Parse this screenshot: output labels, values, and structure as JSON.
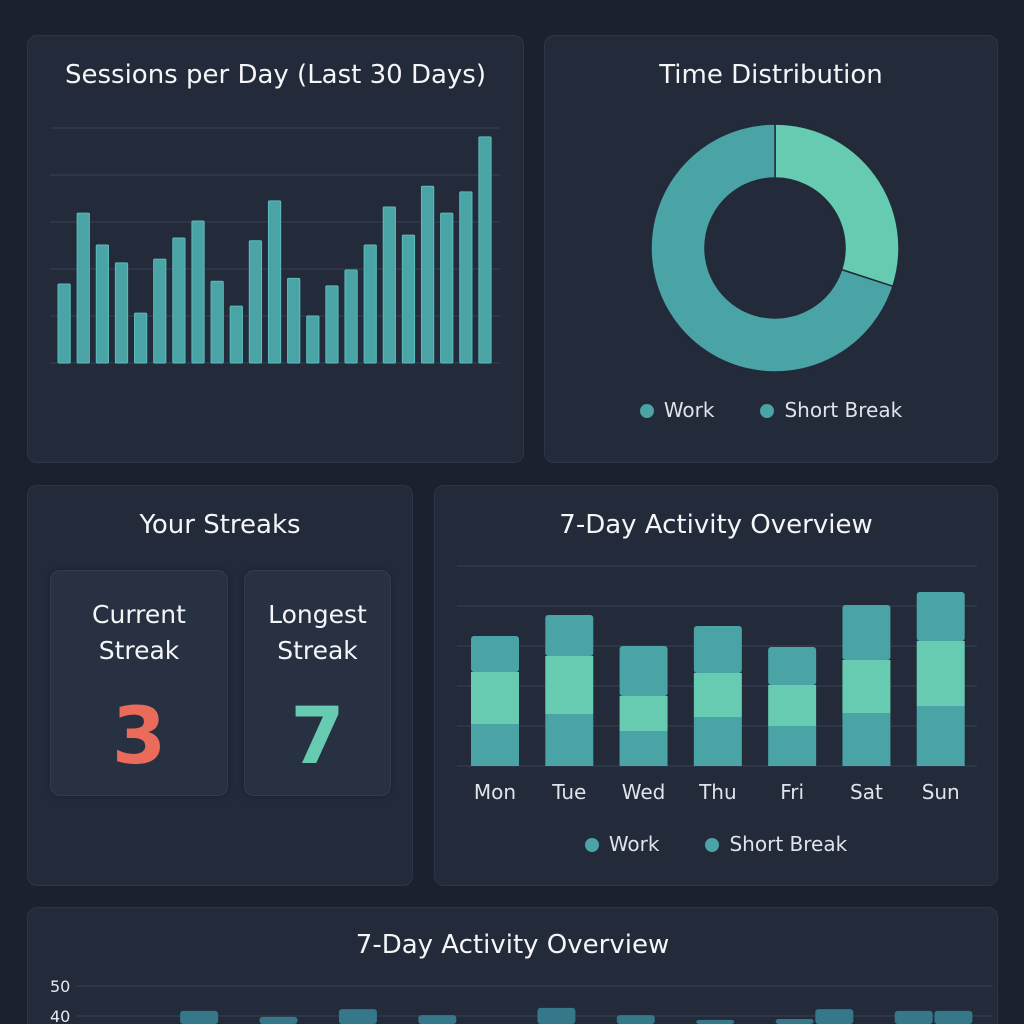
{
  "colors": {
    "work": "#4aa3a5",
    "short_break": "#66cbb0",
    "current": "#ea6b5a",
    "longest": "#66cbb0",
    "grid": "#2f3a4b",
    "bottom_bar": "#34788a"
  },
  "sessions": {
    "title": "Sessions per Day (Last 30 Days)",
    "chart_data": {
      "type": "bar",
      "values": [
        16.8,
        31.9,
        25.1,
        21.3,
        10.6,
        22.1,
        26.6,
        30.2,
        17.4,
        12.1,
        26,
        34.5,
        18,
        10,
        16.4,
        19.8,
        25.1,
        33.2,
        27.2,
        37.6,
        31.9,
        36.4,
        48.1
      ],
      "ylim": [
        0,
        50
      ],
      "grid": true
    }
  },
  "distribution": {
    "title": "Time Distribution",
    "chart_data": {
      "type": "pie",
      "labels": [
        "Work",
        "Short Break"
      ],
      "values": [
        70,
        30
      ]
    },
    "legend": [
      "Work",
      "Short Break"
    ]
  },
  "streaks": {
    "title": "Your Streaks",
    "current_label_1": "Current",
    "current_label_2": "Streak",
    "current_value": "3",
    "longest_label_1": "Longest",
    "longest_label_2": "Streak",
    "longest_value": "7"
  },
  "activity": {
    "title": "7-Day Activity Overview",
    "chart_data": {
      "type": "bar",
      "stacked": true,
      "categories": [
        "Mon",
        "Tue",
        "Wed",
        "Thu",
        "Fri",
        "Sat",
        "Sun"
      ],
      "series": [
        {
          "name": "Work",
          "values": [
            10.5,
            13,
            8.75,
            12.25,
            10,
            13.25,
            15
          ]
        },
        {
          "name": "Short Break",
          "values": [
            13,
            14.5,
            8.75,
            11,
            10.25,
            13.25,
            16.25
          ]
        },
        {
          "name": "Work",
          "values": [
            9,
            10.25,
            12.5,
            11.75,
            9.5,
            13.75,
            12.25
          ]
        }
      ],
      "ylim": [
        0,
        50
      ]
    },
    "legend": [
      "Work",
      "Short Break"
    ]
  },
  "bottom": {
    "title": "7-Day Activity Overview",
    "chart_data": {
      "type": "bar",
      "yticks": [
        "50",
        "40"
      ],
      "ylim": [
        0,
        50
      ],
      "values": [
        null,
        null,
        null,
        41.7,
        null,
        39.7,
        null,
        42.3,
        null,
        40.3,
        null,
        null,
        42.7,
        null,
        40.3,
        null,
        38.7,
        null,
        39,
        42.3,
        null,
        41.7,
        41.7
      ]
    }
  }
}
